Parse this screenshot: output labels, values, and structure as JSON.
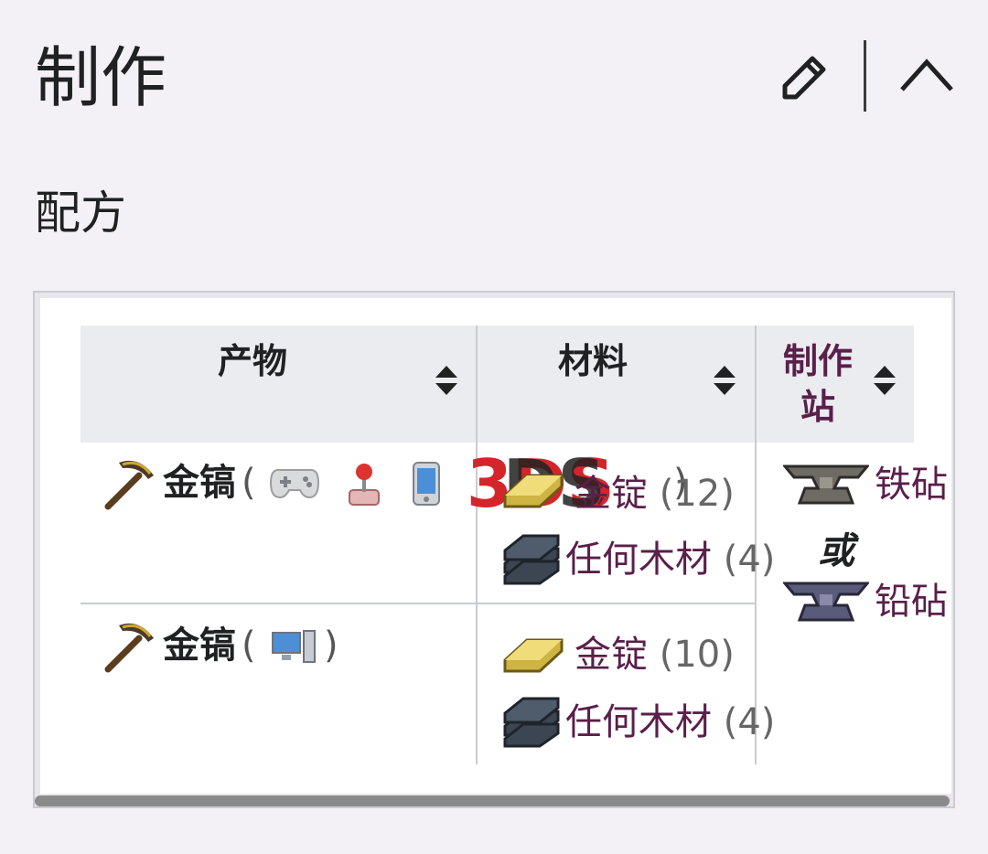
{
  "section": {
    "title": "制作"
  },
  "subsection": {
    "title": "配方"
  },
  "header_icons": [
    "pencil-icon",
    "chevron-up-icon"
  ],
  "table": {
    "headers": {
      "products": "产物",
      "materials": "材料",
      "station": "制作站"
    },
    "rows": [
      {
        "product": "金镐",
        "open_paren": "(",
        "close_paren": ")",
        "platform_icons": [
          "controller-icon",
          "joystick-icon",
          "mobile-icon",
          "3ds-logo"
        ],
        "ingredients": [
          {
            "name": "金锭",
            "qty": "(12)",
            "icon": "gold-bar-icon"
          },
          {
            "name": "任何木材",
            "qty": "(4)",
            "icon": "wood-icon"
          }
        ]
      },
      {
        "product": "金镐",
        "open_paren": "(",
        "close_paren": ")",
        "platform_icons": [
          "desktop-pc-icon"
        ],
        "ingredients": [
          {
            "name": "金锭",
            "qty": "(10)",
            "icon": "gold-bar-icon"
          },
          {
            "name": "任何木材",
            "qty": "(4)",
            "icon": "wood-icon"
          }
        ]
      }
    ],
    "stations": {
      "first": "铁砧",
      "or": "或",
      "second": "铅砧"
    },
    "logo_text": "3DS"
  },
  "colors": {
    "link": "#5a1f4a",
    "header_bg": "#eaecf0",
    "page_bg": "#f3f1f5"
  }
}
